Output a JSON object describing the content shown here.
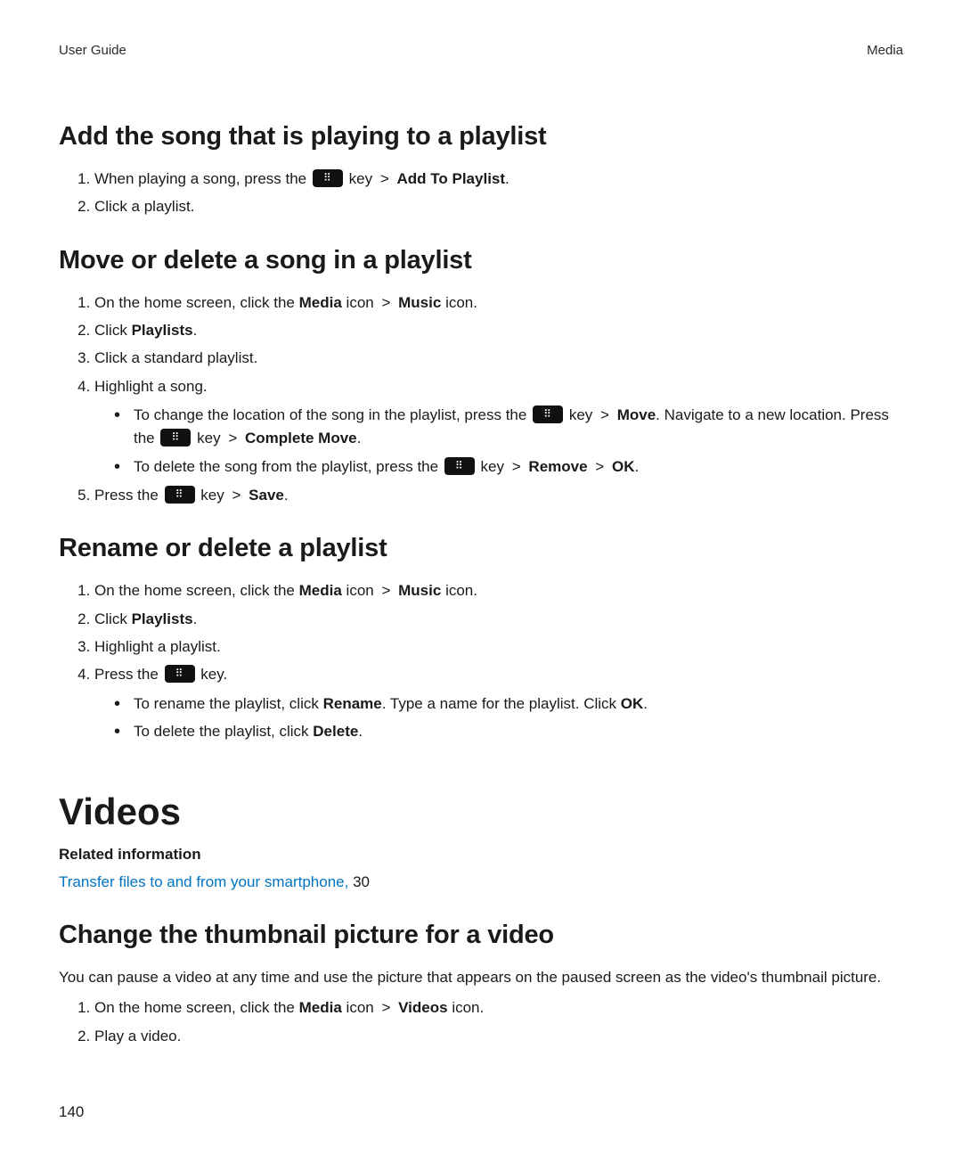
{
  "runhead": {
    "left": "User Guide",
    "right": "Media"
  },
  "page_number": "140",
  "sep": ">",
  "bb_key_word": "key",
  "s1": {
    "heading": "Add the song that is playing to a playlist",
    "steps": [
      {
        "pre": "When playing a song, press the",
        "has_icon": true,
        "post": "",
        "bold": "Add To Playlist",
        "tail": "."
      },
      {
        "pre": "Click a playlist."
      }
    ]
  },
  "s2": {
    "heading": "Move or delete a song in a playlist",
    "steps_a": {
      "1": {
        "pre": "On the home screen, click the",
        "b1": "Media",
        "mid1": "icon",
        "b2": "Music",
        "mid2": "icon."
      },
      "2": {
        "pre": "Click",
        "b1": "Playlists",
        "tail": "."
      },
      "3": {
        "pre": "Click a standard playlist."
      },
      "4": {
        "pre": "Highlight a song."
      }
    },
    "bullets": {
      "0": {
        "t1": "To change the location of the song in the playlist, press the",
        "a1": "Move",
        "t2": ". Navigate to a new location. Press the",
        "a2": "Complete Move",
        "t3": "."
      },
      "1": {
        "t1": "To delete the song from the playlist, press the",
        "a1": "Remove",
        "a2": "OK",
        "t2": "."
      }
    },
    "step5": {
      "pre": "Press the",
      "a1": "Save",
      "tail": "."
    }
  },
  "s3": {
    "heading": "Rename or delete a playlist",
    "steps": {
      "1": {
        "pre": "On the home screen, click the",
        "b1": "Media",
        "mid1": "icon",
        "b2": "Music",
        "mid2": "icon."
      },
      "2": {
        "pre": "Click",
        "b1": "Playlists",
        "tail": "."
      },
      "3": {
        "pre": "Highlight a playlist."
      },
      "4": {
        "pre": "Press the",
        "tail": "key."
      }
    },
    "bullets": {
      "0": {
        "t1": "To rename the playlist, click",
        "b1": "Rename",
        "t2": ". Type a name for the playlist. Click",
        "b2": "OK",
        "t3": "."
      },
      "1": {
        "t1": "To delete the playlist, click",
        "b1": "Delete",
        "t2": "."
      }
    }
  },
  "videos": {
    "title": "Videos",
    "related_heading": "Related information",
    "related_link": "Transfer files to and from your smartphone,",
    "related_page": "30",
    "s1": {
      "heading": "Change the thumbnail picture for a video",
      "intro": "You can pause a video at any time and use the picture that appears on the paused screen as the video's thumbnail picture.",
      "steps": {
        "1": {
          "pre": "On the home screen, click the",
          "b1": "Media",
          "mid1": "icon",
          "b2": "Videos",
          "mid2": "icon."
        },
        "2": {
          "pre": "Play a video."
        }
      }
    }
  }
}
